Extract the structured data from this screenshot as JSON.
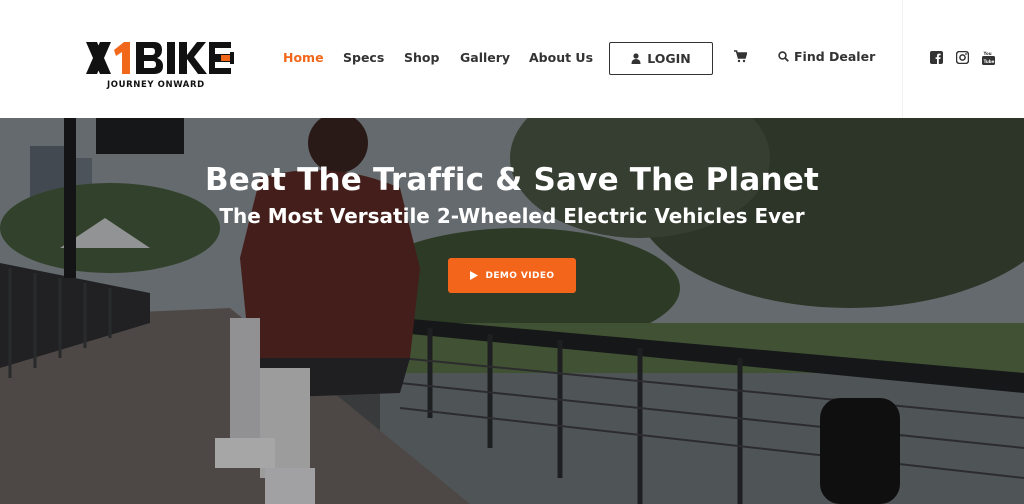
{
  "brand": {
    "logo_text": "X1BIKE",
    "tagline": "JOURNEY ONWARD"
  },
  "nav": {
    "items": [
      {
        "label": "Home",
        "active": true
      },
      {
        "label": "Specs",
        "active": false
      },
      {
        "label": "Shop",
        "active": false
      },
      {
        "label": "Gallery",
        "active": false
      },
      {
        "label": "About Us",
        "active": false
      }
    ],
    "login_label": "LOGIN",
    "cart_icon": "cart-icon",
    "find_dealer_label": "Find Dealer",
    "social": [
      "facebook-icon",
      "instagram-icon",
      "youtube-icon"
    ]
  },
  "hero": {
    "title": "Beat The Traffic & Save The Planet",
    "subtitle": "The Most Versatile 2-Wheeled Electric Vehicles Ever",
    "cta_label": "DEMO VIDEO",
    "cta_icon": "play-icon"
  },
  "colors": {
    "accent": "#f2681b",
    "button_orange": "#f4651c",
    "text_dark": "#333333"
  }
}
